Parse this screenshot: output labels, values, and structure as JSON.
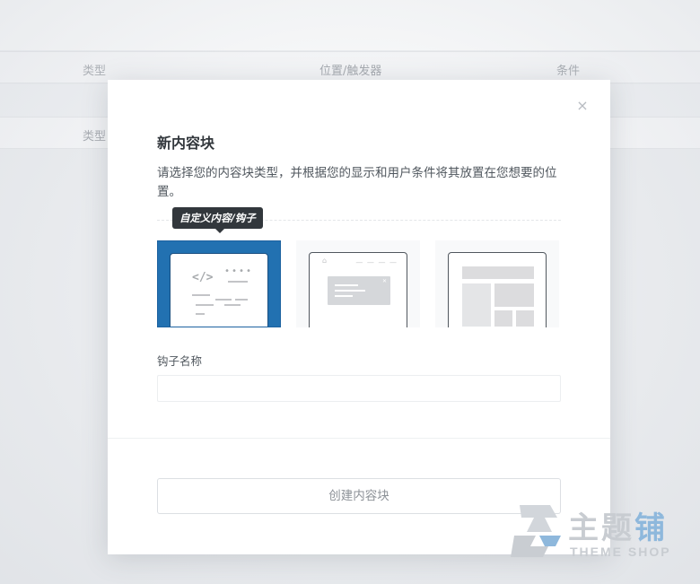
{
  "background_table": {
    "rows": [
      {
        "type": "类型",
        "position": "位置/触发器",
        "condition": "条件"
      },
      {
        "type": "类型"
      }
    ]
  },
  "modal": {
    "close_symbol": "×",
    "title": "新内容块",
    "description": "请选择您的内容块类型，并根据您的显示和用户条件将其放置在您想要的位置。",
    "tooltip": "自定义内容/钩子",
    "cards": [
      {
        "name": "custom-content-hook",
        "selected": true,
        "code_symbol": "</>"
      },
      {
        "name": "popup",
        "selected": false
      },
      {
        "name": "layout",
        "selected": false
      }
    ],
    "field": {
      "label": "钩子名称",
      "value": "",
      "placeholder": ""
    },
    "submit_label": "创建内容块"
  },
  "watermark": {
    "title_main": "主题",
    "title_accent": "铺",
    "subtitle": "THEME SHOP"
  },
  "colors": {
    "accent": "#2271b1",
    "title_text": "#32373c",
    "tooltip_bg": "#32373c"
  }
}
